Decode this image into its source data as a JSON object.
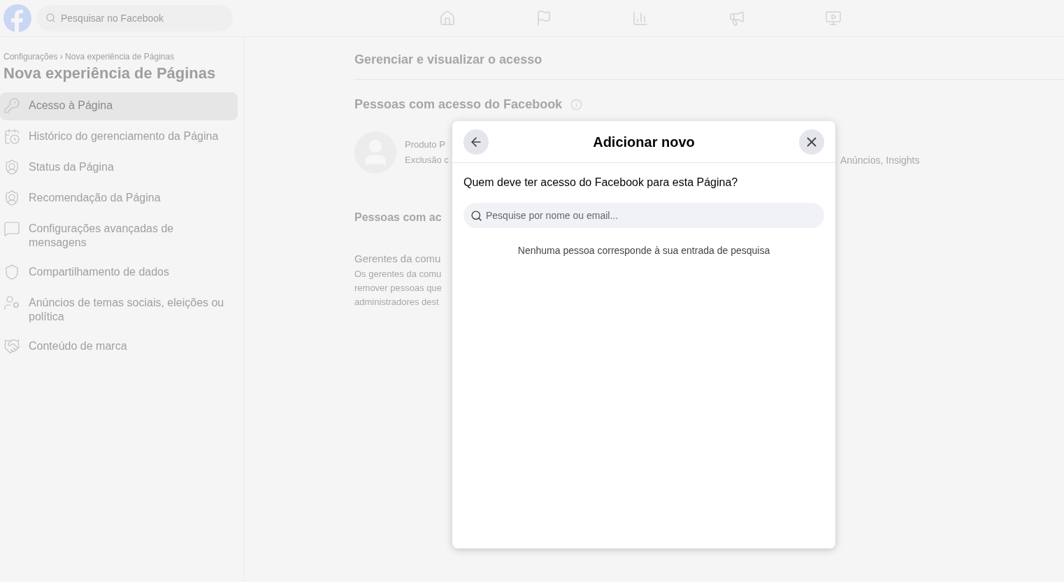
{
  "topbar": {
    "search": {
      "placeholder": "Pesquisar no Facebook"
    }
  },
  "sidebar": {
    "breadcrumb": "Configurações › Nova experiência de Páginas",
    "title": "Nova experiência de Páginas",
    "items": [
      {
        "label": "Acesso à Página",
        "selected": true
      },
      {
        "label": "Histórico do gerenciamento da Página",
        "selected": false
      },
      {
        "label": "Status da Página",
        "selected": false
      },
      {
        "label": "Recomendação da Página",
        "selected": false
      },
      {
        "label": "Configurações avançadas de mensagens",
        "selected": false
      },
      {
        "label": "Compartilhamento de dados",
        "selected": false
      },
      {
        "label": "Anúncios de temas sociais, eleições ou política",
        "selected": false
      },
      {
        "label": "Conteúdo de marca",
        "selected": false
      }
    ]
  },
  "main": {
    "heading": "Gerenciar e visualizar o acesso",
    "section_1": {
      "title": "Pessoas com acesso do Facebook",
      "person": {
        "name": "Produto P",
        "detail": "Exclusão c",
        "permissions": "Anúncios, Insights"
      }
    },
    "section_2": {
      "title": "Pessoas com ac",
      "subtitle": "Gerentes da comu",
      "description_lines": [
        "Os gerentes da comu",
        "remover pessoas que",
        "administradores dest"
      ]
    }
  },
  "dialog": {
    "title": "Adicionar novo",
    "question": "Quem deve ter acesso do Facebook para esta Página?",
    "search": {
      "placeholder": "Pesquise por nome ou email..."
    },
    "empty_message": "Nenhuma pessoa corresponde à sua entrada de pesquisa"
  }
}
